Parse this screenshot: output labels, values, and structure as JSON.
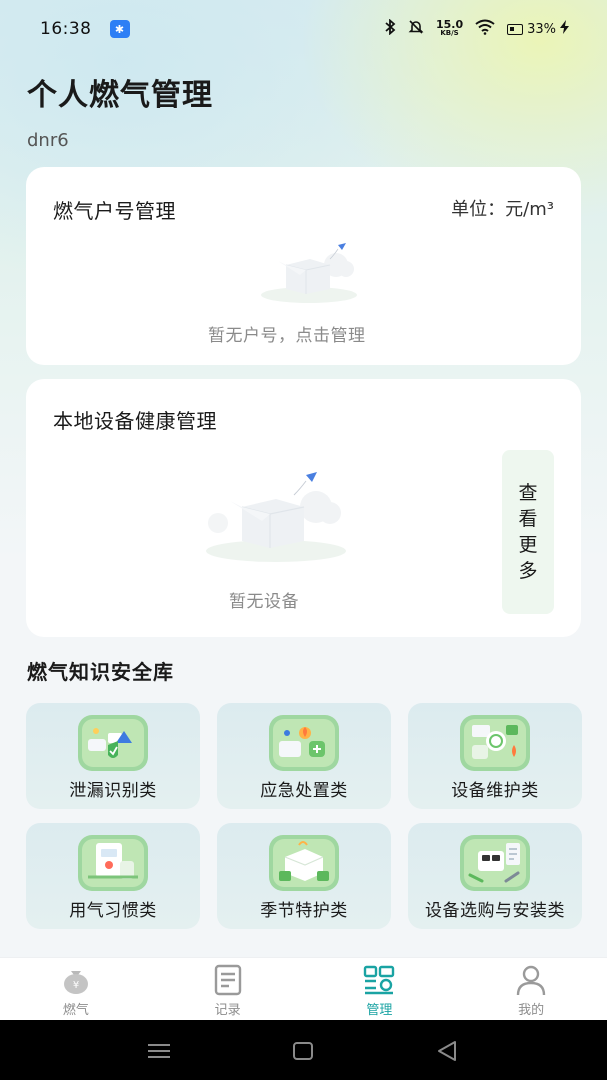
{
  "status_bar": {
    "time": "16:38",
    "net_speed_value": "15.0",
    "net_speed_unit": "KB/S",
    "battery": "33%"
  },
  "header": {
    "title": "个人燃气管理",
    "username": "dnr6"
  },
  "account_card": {
    "title": "燃气户号管理",
    "unit": "单位：元/m³",
    "empty_text": "暂无户号，点击管理"
  },
  "device_card": {
    "title": "本地设备健康管理",
    "empty_text": "暂无设备",
    "more_label": [
      "查",
      "看",
      "更",
      "多"
    ]
  },
  "knowledge": {
    "title": "燃气知识安全库",
    "items": [
      {
        "label": "泄漏识别类",
        "icon": "leak-detection-icon"
      },
      {
        "label": "应急处置类",
        "icon": "emergency-handling-icon"
      },
      {
        "label": "设备维护类",
        "icon": "device-maintenance-icon"
      },
      {
        "label": "用气习惯类",
        "icon": "gas-usage-habit-icon"
      },
      {
        "label": "季节特护类",
        "icon": "seasonal-care-icon"
      },
      {
        "label": "设备选购与安装类",
        "icon": "purchase-install-icon"
      }
    ]
  },
  "tabs": [
    {
      "label": "燃气",
      "icon": "gas-money-bag-icon",
      "active": false
    },
    {
      "label": "记录",
      "icon": "receipt-icon",
      "active": false
    },
    {
      "label": "管理",
      "icon": "manage-icon",
      "active": true
    },
    {
      "label": "我的",
      "icon": "user-icon",
      "active": false
    }
  ],
  "colors": {
    "accent": "#1aa3a3",
    "tile_bg": "#dcebef",
    "more_bg": "#eef7ef"
  }
}
